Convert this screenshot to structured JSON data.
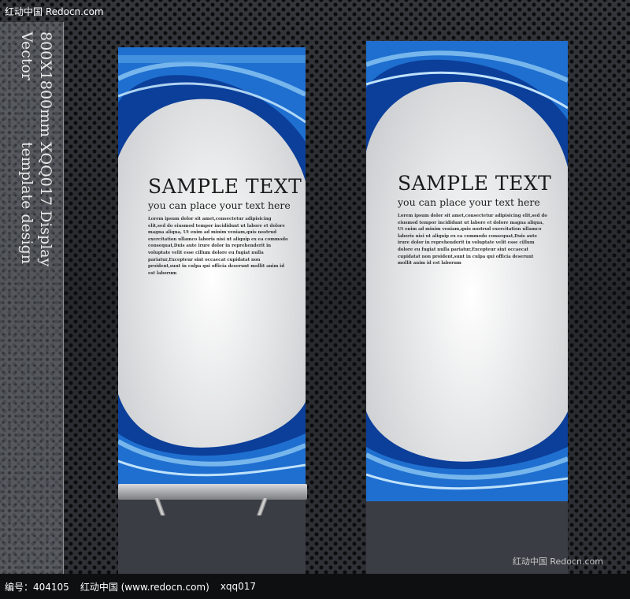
{
  "watermark_top": "红动中国 Redocn.com",
  "side_label": {
    "line1": "XQQ017 Display template design",
    "line2": "800X1800mm Vector"
  },
  "banners": [
    {
      "title": "SAMPLE TEXT",
      "subtitle": "you can place your text here",
      "body": "Lorem ipsum dolor sit amet,consectetur adipisicing elit,sed do eiusmod tempor incididunt ut labore et dolore magna aliqua, Ut enim ad minim veniam,quis nostrud exercitation ullamco laboris nisi ut aliquip ex ea commodo consequat,Duis aute irure dolor in reprehenderit in voluptate velit esse cillum dolore eu fugiat nulla pariatur,Excepteur sint occaecat cupidatat non proident,sunt in culpa qui officia deserunt mollit anim id est laborum"
    },
    {
      "title": "SAMPLE TEXT",
      "subtitle": "you can place your text here",
      "body": "Lorem ipsum dolor sit amet,consectetur adipisicing elit,sed do eiusmod tempor incididunt ut labore et dolore magna aliqua, Ut enim ad minim veniam,quis nostrud exercitation ullamco laboris nisi ut aliquip ex ea commodo consequat,Duis aute irure dolor in reprehenderit in voluptate velit esse cillum dolore eu fugiat nulla pariatur,Excepteur sint occaecat cupidatat non proident,sunt in culpa qui officia deserunt mollit anim id est laborum"
    }
  ],
  "footer": {
    "id_label": "编号：404105",
    "site": "红动中国 (www.redocn.com)",
    "code": "xqq017"
  },
  "footer_watermark": "红动中国 Redocn.com",
  "colors": {
    "wave_dark": "#0b3f9a",
    "wave_mid": "#1f6fd0",
    "wave_light": "#8cc8f2",
    "panel": "#e9eaec"
  }
}
